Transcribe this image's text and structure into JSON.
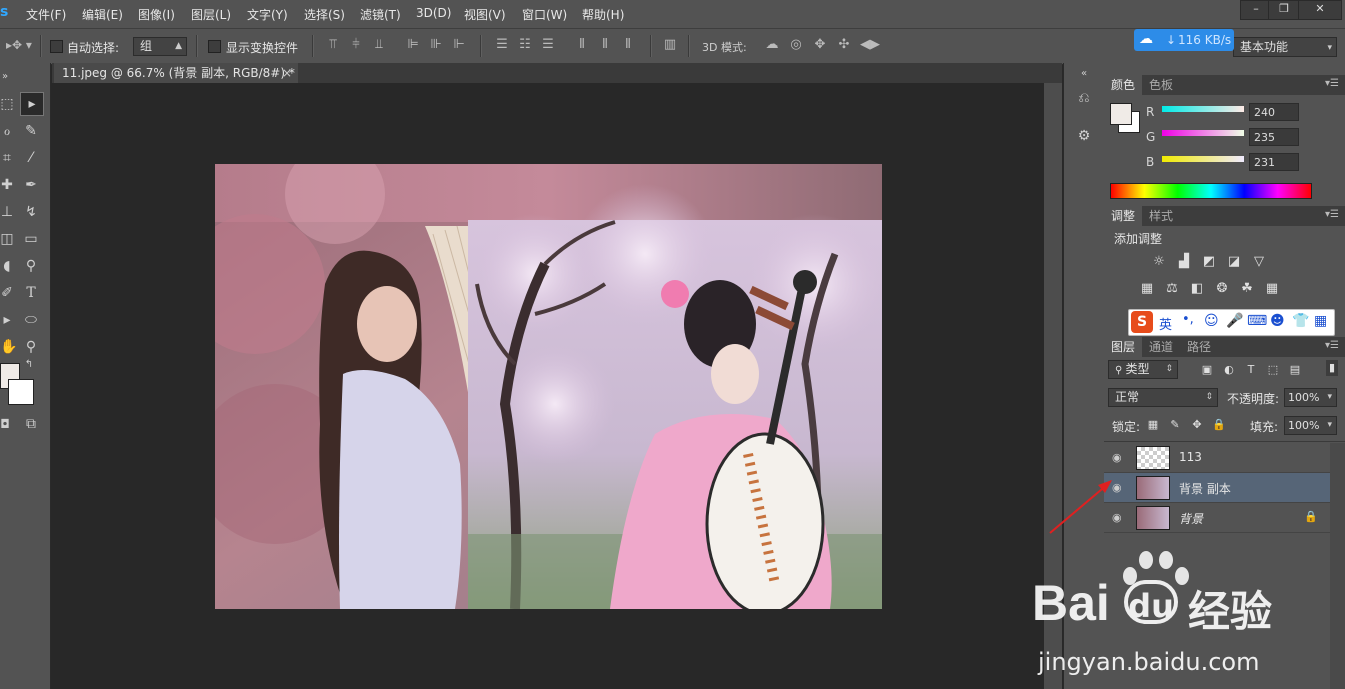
{
  "menubar": {
    "logo": "s",
    "items": [
      "文件(F)",
      "编辑(E)",
      "图像(I)",
      "图层(L)",
      "文字(Y)",
      "选择(S)",
      "滤镜(T)",
      "3D(D)",
      "视图(V)",
      "窗口(W)",
      "帮助(H)"
    ],
    "window_controls": [
      "–",
      "❐",
      "✕"
    ]
  },
  "options": {
    "auto_select_label": "自动选择:",
    "auto_select_value": "组",
    "show_transform_label": "显示变换控件",
    "mode_3d_label": "3D 模式:",
    "workspace": "基本功能"
  },
  "network_speed": "116 KB/s",
  "document": {
    "tab_title": "11.jpeg @ 66.7% (背景 副本, RGB/8#) *",
    "close": "×"
  },
  "color_panel": {
    "tabs": [
      "颜色",
      "色板"
    ],
    "r": "240",
    "g": "235",
    "b": "231",
    "r_label": "R",
    "g_label": "G",
    "b_label": "B",
    "foreground": "#f0ebe7",
    "background": "#ffffff"
  },
  "adjust_panel": {
    "tabs": [
      "调整",
      "样式"
    ],
    "title": "添加调整"
  },
  "ime_bar": {
    "lang": "英"
  },
  "layers_panel": {
    "tabs": [
      "图层",
      "通道",
      "路径"
    ],
    "filter_kind": "类型",
    "blend_mode": "正常",
    "opacity_label": "不透明度:",
    "opacity": "100%",
    "lock_label": "锁定:",
    "fill_label": "填充:",
    "fill": "100%",
    "layers": [
      {
        "name": "113",
        "selected": false,
        "locked": false
      },
      {
        "name": "背景 副本",
        "selected": true,
        "locked": false
      },
      {
        "name": "背景",
        "selected": false,
        "locked": true
      }
    ]
  },
  "watermark": {
    "brand": "Bai",
    "brand2": "du",
    "cn": "经验",
    "url": "jingyan.baidu.com"
  },
  "colors": {
    "panel_bg": "#535353",
    "canvas_bg": "#282828",
    "selected_layer": "#566577",
    "accent": "#2d8ce8"
  }
}
